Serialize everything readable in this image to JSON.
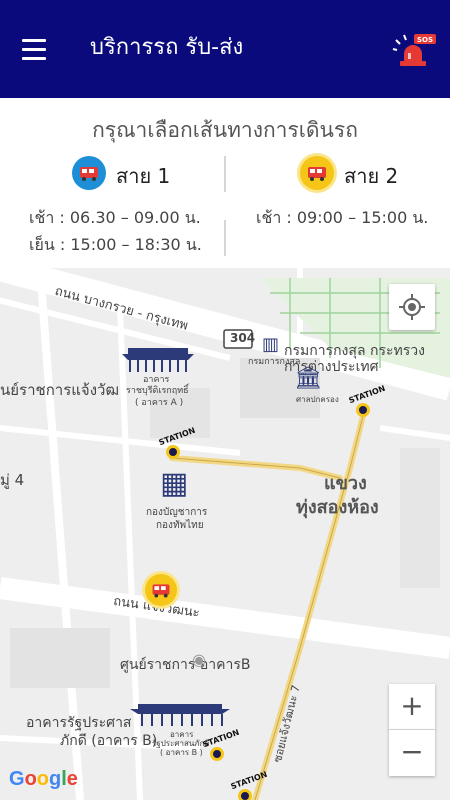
{
  "app": {
    "title": "บริการรถ รับ-ส่ง",
    "menu_icon": "hamburger-menu-icon",
    "sos_icon": "sos-siren-icon",
    "sos_label": "SOS",
    "colors": {
      "appbar": "#0a0a7d",
      "route1": "#1e8fd6",
      "route2": "#f5c518",
      "bus": "#e53935"
    }
  },
  "panel": {
    "title": "กรุณาเลือกเส้นทางการเดินรถ",
    "routes": [
      {
        "name": "สาย 1",
        "icon": "bus-icon",
        "morning": "เช้า : 06.30 – 09.00 น.",
        "evening": "เย็น : 15:00 – 18:30 น."
      },
      {
        "name": "สาย 2",
        "icon": "bus-icon",
        "morning": "เช้า : 09:00 – 15:00 น."
      }
    ]
  },
  "map": {
    "labels": {
      "road_north": "ถนน บางกรวย - กรุงเทพ",
      "road_mid": "ถนน แจ้งวัฒนะ",
      "road_soi": "ซอยแจ้งวัฒนะ 7",
      "route_no": "304",
      "district_1": "แขวง",
      "district_2": "ทุ่งสองห้อง",
      "gov_center": "ศูนย์ราชการ อาคารB",
      "left_gov": "นย์ราชการแจ้งวัฒ",
      "moo": "มู่ 4",
      "consular_1": "กรมการกงสุล กระทรวง",
      "consular_2": "การต่างประเทศ",
      "consular_small": "กรมการกงสุล",
      "tax_office": "ศาลปกครอง",
      "bldg_a_1": "อาคาร",
      "bldg_a_2": "ราชบุรีดิเรกฤทธิ์",
      "bldg_a_3": "( อาคาร A )",
      "finance_1": "กองบัญชาการ",
      "finance_2": "กองทัพไทย",
      "bldg_b_1": "อาคารรัฐประศาส",
      "bldg_b_2": "ภักดี (อาคาร B)",
      "bldg_b_small_1": "อาคาร",
      "bldg_b_small_2": "รัฐประศาสนภักดี",
      "bldg_b_small_3": "( อาคาร B )",
      "station": "STATION",
      "google": "Google"
    },
    "controls": {
      "locate_icon": "my-location-icon",
      "zoom_in": "+",
      "zoom_out": "−"
    }
  }
}
